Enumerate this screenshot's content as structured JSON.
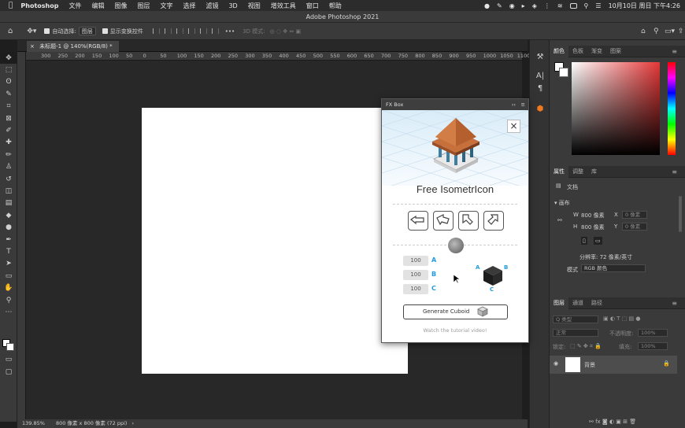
{
  "menubar": {
    "apple": "",
    "app_name": "Photoshop",
    "items": [
      "文件",
      "编辑",
      "图像",
      "图层",
      "文字",
      "选择",
      "滤镜",
      "3D",
      "视图",
      "增效工具",
      "窗口",
      "帮助"
    ],
    "clock": "10月10日 周日 下午4:26"
  },
  "window": {
    "title": "Adobe Photoshop 2021"
  },
  "options": {
    "auto_select_label": "自动选择:",
    "auto_select_value": "图层",
    "show_transform_label": "显示变换控件",
    "mode_3d_label": "3D 模式:"
  },
  "document": {
    "tab_label": "未标题-1 @ 140%(RGB/8) *",
    "status_zoom": "139.85%",
    "status_info": "800 像素 x 800 像素 (72 ppi)"
  },
  "ruler": {
    "ticks": [
      "300",
      "250",
      "200",
      "150",
      "100",
      "50",
      "0",
      "50",
      "100",
      "150",
      "200",
      "250",
      "300",
      "350",
      "400",
      "450",
      "500",
      "550",
      "600",
      "650",
      "700",
      "750",
      "800",
      "850",
      "900",
      "950",
      "1000",
      "1050",
      "1100"
    ]
  },
  "tools": [
    {
      "icon": "move-icon",
      "glyph": "✥"
    },
    {
      "icon": "marquee-icon",
      "glyph": "⬚"
    },
    {
      "icon": "lasso-icon",
      "glyph": "ʘ"
    },
    {
      "icon": "quick-select-icon",
      "glyph": "✎"
    },
    {
      "icon": "crop-icon",
      "glyph": "⌗"
    },
    {
      "icon": "frame-icon",
      "glyph": "⊠"
    },
    {
      "icon": "eyedropper-icon",
      "glyph": "✐"
    },
    {
      "icon": "healing-icon",
      "glyph": "✚"
    },
    {
      "icon": "brush-icon",
      "glyph": "✏"
    },
    {
      "icon": "stamp-icon",
      "glyph": "♙"
    },
    {
      "icon": "history-brush-icon",
      "glyph": "↺"
    },
    {
      "icon": "eraser-icon",
      "glyph": "◫"
    },
    {
      "icon": "gradient-icon",
      "glyph": "▤"
    },
    {
      "icon": "blur-icon",
      "glyph": "◆"
    },
    {
      "icon": "dodge-icon",
      "glyph": "●"
    },
    {
      "icon": "pen-icon",
      "glyph": "✒"
    },
    {
      "icon": "type-icon",
      "glyph": "T"
    },
    {
      "icon": "path-select-icon",
      "glyph": "➤"
    },
    {
      "icon": "shape-icon",
      "glyph": "▭"
    },
    {
      "icon": "hand-icon",
      "glyph": "✋"
    },
    {
      "icon": "zoom-icon",
      "glyph": "⚲"
    },
    {
      "icon": "more-tools-icon",
      "glyph": "⋯"
    }
  ],
  "color_panel": {
    "tabs": [
      "颜色",
      "色板",
      "渐变",
      "图案"
    ]
  },
  "properties_panel": {
    "tabs": [
      "属性",
      "调整",
      "库"
    ],
    "doc_label": "文档",
    "canvas_label": "画布",
    "w_label": "W",
    "w_value": "800 像素",
    "h_label": "H",
    "h_value": "800 像素",
    "x_label": "X",
    "y_label": "Y",
    "xy_placeholder": "0 像素",
    "resolution": "分辨率: 72 像素/英寸",
    "mode_label": "模式",
    "mode_value": "RGB 颜色"
  },
  "layers_panel": {
    "tabs": [
      "图层",
      "通道",
      "路径"
    ],
    "filter_label": "Q 类型",
    "blend_mode": "正常",
    "opacity_label": "不透明度:",
    "opacity_value": "100%",
    "lock_label": "锁定:",
    "fill_label": "填充:",
    "fill_value": "100%",
    "layer_name": "背景"
  },
  "fxbox": {
    "panel_title": "FX Box",
    "title": "Free IsometrIcon",
    "dims": [
      {
        "value": "100",
        "letter": "A"
      },
      {
        "value": "100",
        "letter": "B"
      },
      {
        "value": "100",
        "letter": "C"
      }
    ],
    "cube_labels": {
      "a": "A",
      "b": "B",
      "c": "C"
    },
    "generate_label": "Generate Cuboid",
    "tutorial_link": "Watch the tutorial video!",
    "accent": "#1e9be0"
  }
}
